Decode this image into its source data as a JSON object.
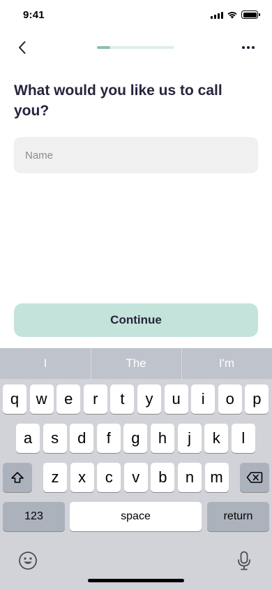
{
  "status_bar": {
    "time": "9:41",
    "icons": [
      "cellular-signal-icon",
      "wifi-icon",
      "battery-icon"
    ]
  },
  "nav": {
    "back_icon": "chevron-left-icon",
    "more_icon": "more-horizontal-icon",
    "progress_fraction": 0.17
  },
  "title": "What would you like us to call you?",
  "name_field": {
    "placeholder": "Name",
    "value": ""
  },
  "continue_label": "Continue",
  "colors": {
    "accent": "#c4e3da",
    "progress_fill": "#8fbfb2",
    "progress_track": "#e2eeea",
    "title_text": "#27243c"
  },
  "keyboard": {
    "suggestions": [
      "I",
      "The",
      "I'm"
    ],
    "row1": [
      "q",
      "w",
      "e",
      "r",
      "t",
      "y",
      "u",
      "i",
      "o",
      "p"
    ],
    "row2": [
      "a",
      "s",
      "d",
      "f",
      "g",
      "h",
      "j",
      "k",
      "l"
    ],
    "row3": [
      "z",
      "x",
      "c",
      "v",
      "b",
      "n",
      "m"
    ],
    "shift_icon": "shift-icon",
    "delete_icon": "backspace-icon",
    "numbers_label": "123",
    "space_label": "space",
    "return_label": "return",
    "emoji_icon": "emoji-icon",
    "mic_icon": "microphone-icon"
  }
}
